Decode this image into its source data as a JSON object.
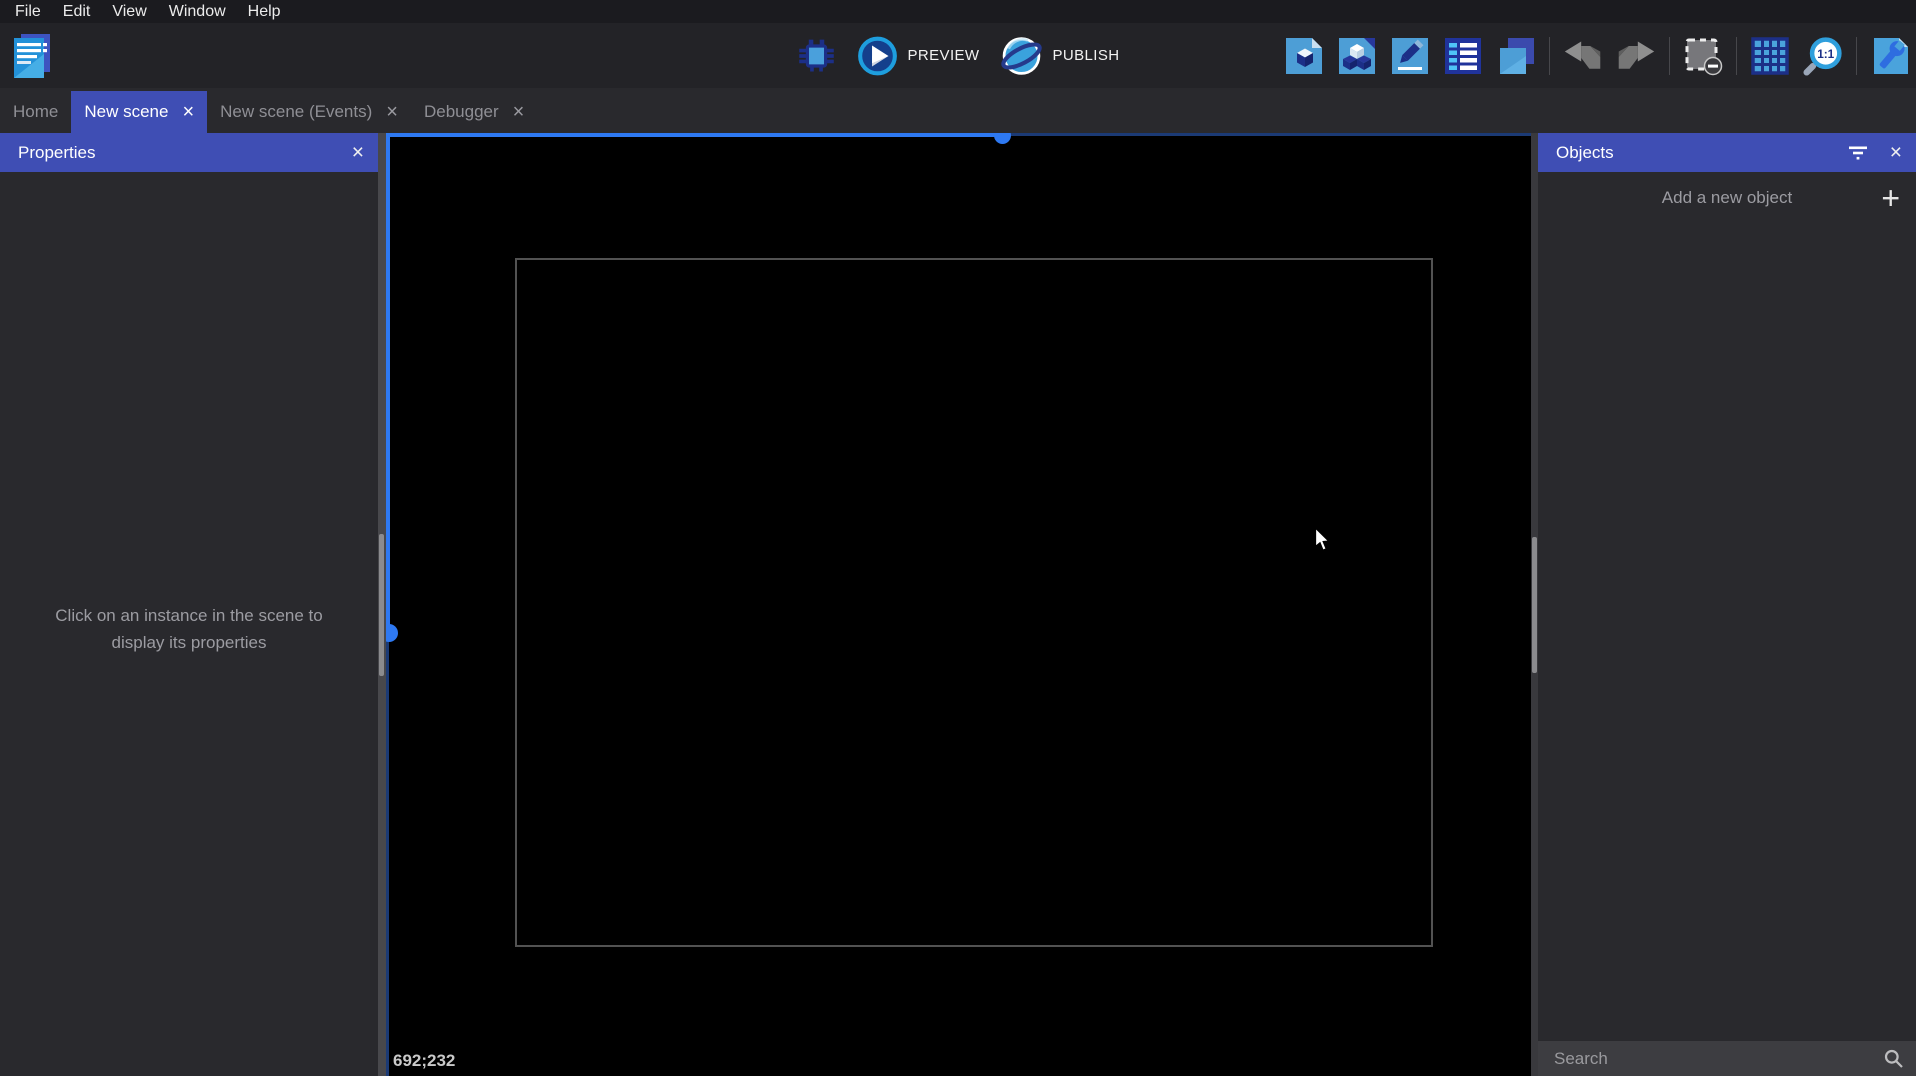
{
  "menubar": {
    "items": [
      "File",
      "Edit",
      "View",
      "Window",
      "Help"
    ]
  },
  "toolbar": {
    "preview_label": "PREVIEW",
    "publish_label": "PUBLISH"
  },
  "tabs": {
    "items": [
      {
        "label": "Home"
      },
      {
        "label": "New scene"
      },
      {
        "label": "New scene (Events)"
      },
      {
        "label": "Debugger"
      }
    ],
    "close_glyph": "×"
  },
  "properties_panel": {
    "title": "Properties",
    "close_glyph": "×",
    "empty_text": "Click on an instance in the scene to display its properties"
  },
  "scene_canvas": {
    "cursor_coordinates": "692;232"
  },
  "objects_panel": {
    "title": "Objects",
    "close_glyph": "×",
    "add_object_label": "Add a new object",
    "plus_glyph": "+",
    "search_placeholder": "Search"
  },
  "colors": {
    "accent_selection_blue": "#2e79f2",
    "dark_selection_blue": "#1b3a75",
    "header_indigo": "#3f4eb4",
    "canvas_background": "#000000",
    "panel_background": "#29292d"
  }
}
